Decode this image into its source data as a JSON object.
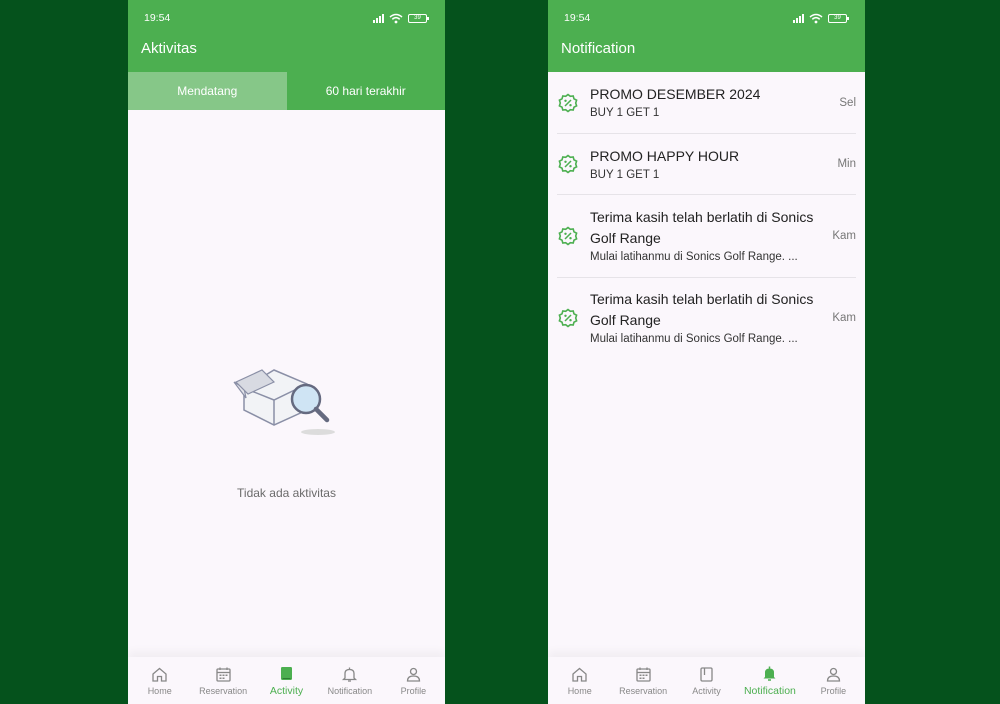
{
  "status": {
    "time": "19:54",
    "battery": "39"
  },
  "activity_screen": {
    "title": "Aktivitas",
    "tabs": [
      {
        "label": "Mendatang",
        "active": true
      },
      {
        "label": "60 hari terakhir",
        "active": false
      }
    ],
    "empty_text": "Tidak ada aktivitas"
  },
  "notification_screen": {
    "title": "Notification",
    "items": [
      {
        "title": "PROMO DESEMBER 2024",
        "subtitle": "BUY 1 GET 1",
        "day": "Sel",
        "icon": "discount-badge-icon"
      },
      {
        "title": "PROMO HAPPY HOUR",
        "subtitle": "BUY 1 GET 1",
        "day": "Min",
        "icon": "discount-badge-icon"
      },
      {
        "title": "Terima kasih telah berlatih di Sonics Golf Range",
        "subtitle": "Mulai latihanmu di Sonics Golf Range. ...",
        "day": "Kam",
        "icon": "discount-badge-icon"
      },
      {
        "title": "Terima kasih telah berlatih di Sonics Golf Range",
        "subtitle": "Mulai latihanmu di Sonics Golf Range. ...",
        "day": "Kam",
        "icon": "discount-badge-icon"
      }
    ]
  },
  "bottom_nav": {
    "items": [
      {
        "label": "Home",
        "icon": "home-icon"
      },
      {
        "label": "Reservation",
        "icon": "calendar-icon"
      },
      {
        "label": "Activity",
        "icon": "book-icon"
      },
      {
        "label": "Notification",
        "icon": "bell-icon"
      },
      {
        "label": "Profile",
        "icon": "person-icon"
      }
    ],
    "active_left": "Activity",
    "active_right": "Notification"
  },
  "colors": {
    "primary": "#4caf50",
    "tab_active": "#86c788",
    "background": "#05521c"
  }
}
